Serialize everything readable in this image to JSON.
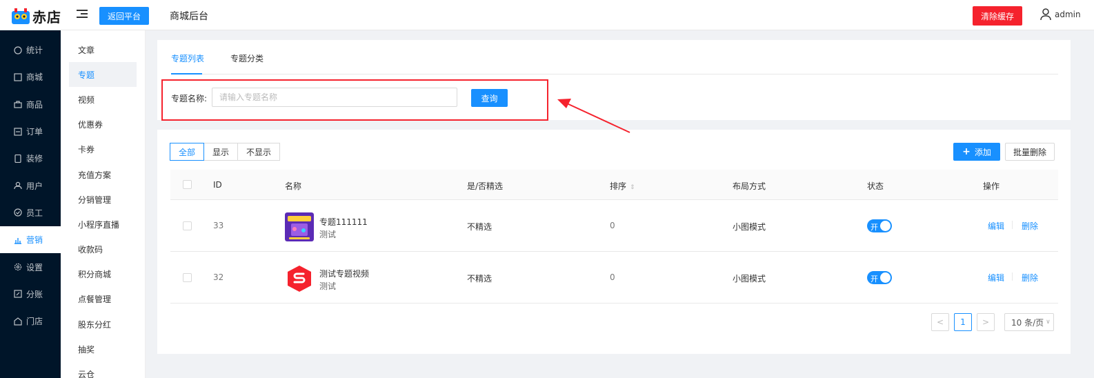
{
  "header": {
    "logo_text": "赤店",
    "back_button": "返回平台",
    "site_title": "商城后台",
    "clear_cache_button": "清除缓存",
    "username": "admin"
  },
  "sidebar": {
    "items": [
      {
        "label": "统计",
        "icon": "chart-icon"
      },
      {
        "label": "商城",
        "icon": "store-icon"
      },
      {
        "label": "商品",
        "icon": "bag-icon"
      },
      {
        "label": "订单",
        "icon": "order-icon"
      },
      {
        "label": "装修",
        "icon": "phone-icon"
      },
      {
        "label": "用户",
        "icon": "user-icon"
      },
      {
        "label": "员工",
        "icon": "staff-icon"
      },
      {
        "label": "营销",
        "icon": "marketing-icon",
        "active": true
      },
      {
        "label": "设置",
        "icon": "gear-icon"
      },
      {
        "label": "分账",
        "icon": "split-icon"
      },
      {
        "label": "门店",
        "icon": "shop-icon"
      }
    ]
  },
  "subsidebar": {
    "items": [
      {
        "label": "文章"
      },
      {
        "label": "专题",
        "active": true
      },
      {
        "label": "视频"
      },
      {
        "label": "优惠券"
      },
      {
        "label": "卡券"
      },
      {
        "label": "充值方案"
      },
      {
        "label": "分销管理"
      },
      {
        "label": "小程序直播"
      },
      {
        "label": "收款码"
      },
      {
        "label": "积分商城"
      },
      {
        "label": "点餐管理"
      },
      {
        "label": "股东分红"
      },
      {
        "label": "抽奖"
      },
      {
        "label": "云仓"
      }
    ]
  },
  "tabs": [
    "专题列表",
    "专题分类"
  ],
  "search": {
    "label": "专题名称:",
    "placeholder": "请输入专题名称",
    "value": "",
    "button": "查询"
  },
  "filters": [
    "全部",
    "显示",
    "不显示"
  ],
  "actions": {
    "add": "添加",
    "batch_delete": "批量删除"
  },
  "table": {
    "columns": [
      "ID",
      "名称",
      "是/否精选",
      "排序",
      "布局方式",
      "状态",
      "操作"
    ],
    "rows": [
      {
        "id": "33",
        "title": "专题111111",
        "subtitle": "测试",
        "featured": "不精选",
        "sort": "0",
        "layout": "小图模式",
        "status": "开",
        "status_on": true,
        "edit": "编辑",
        "delete": "删除"
      },
      {
        "id": "32",
        "title": "测试专题视频",
        "subtitle": "测试",
        "featured": "不精选",
        "sort": "0",
        "layout": "小图模式",
        "status": "开",
        "status_on": true,
        "edit": "编辑",
        "delete": "删除"
      }
    ]
  },
  "pagination": {
    "prev": "<",
    "current": "1",
    "next": ">",
    "page_size": "10 条/页"
  },
  "colors": {
    "primary": "#1890ff",
    "danger": "#f5222d",
    "sidebar_bg": "#001529"
  }
}
